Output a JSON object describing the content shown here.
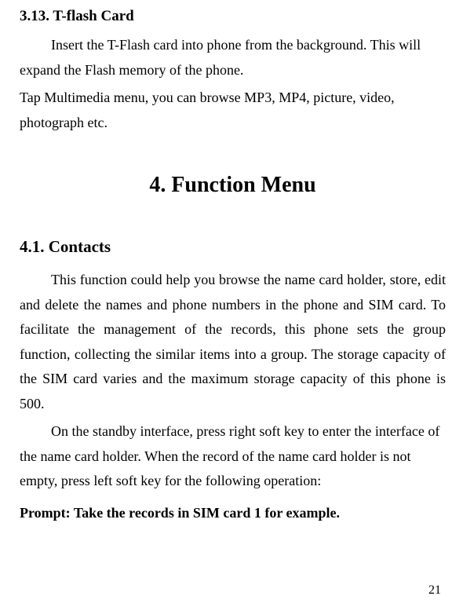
{
  "section313": {
    "heading": "3.13. T-flash Card",
    "para1": "Insert the T-Flash card into phone from the background. This will expand the Flash memory of the phone.",
    "para2": "Tap Multimedia menu, you can browse MP3, MP4, picture, video, photograph etc."
  },
  "chapter4": {
    "heading": "4.   Function Menu"
  },
  "section41": {
    "heading": "4.1.   Contacts",
    "para1": "This function could help you browse the name card holder, store, edit and delete the names and phone numbers in the phone and SIM card. To facilitate the management of the records, this phone sets the group function, collecting the similar items into a group. The storage capacity of the SIM card varies and the maximum storage capacity of this phone is 500.",
    "para2": "On the standby interface, press right soft key to enter the interface of the name card holder. When the record of the name card holder is not empty, press left soft key for the following operation:",
    "prompt": "Prompt: Take the records in SIM card 1 for example."
  },
  "pageNumber": "21"
}
